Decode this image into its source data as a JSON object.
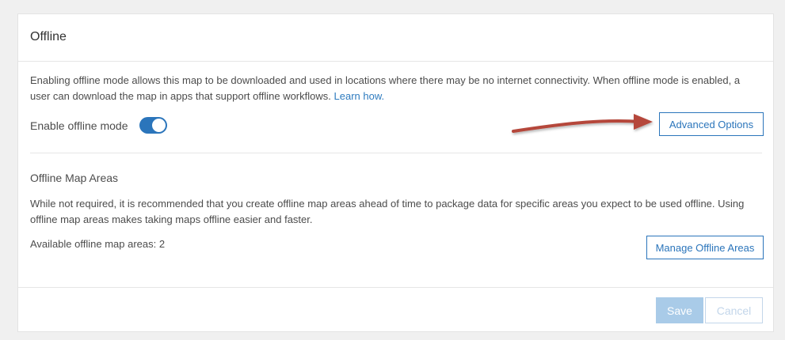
{
  "card": {
    "title": "Offline"
  },
  "offline_mode": {
    "description": "Enabling offline mode allows this map to be downloaded and used in locations where there may be no internet connectivity. When offline mode is enabled, a user can download the map in apps that support offline workflows.",
    "learn_link": "Learn how.",
    "toggle_label": "Enable offline mode",
    "toggle_on": true,
    "advanced_button": "Advanced Options"
  },
  "map_areas": {
    "heading": "Offline Map Areas",
    "description": "While not required, it is recommended that you create offline map areas ahead of time to package data for specific areas you expect to be used offline. Using offline map areas makes taking maps offline easier and faster.",
    "available_label": "Available offline map areas: 2",
    "manage_button": "Manage Offline Areas"
  },
  "footer": {
    "save_label": "Save",
    "cancel_label": "Cancel"
  },
  "colors": {
    "accent": "#2b75bb",
    "annotation_arrow": "#b5473a"
  },
  "icons": {
    "annotation": "red-arrow-icon"
  }
}
